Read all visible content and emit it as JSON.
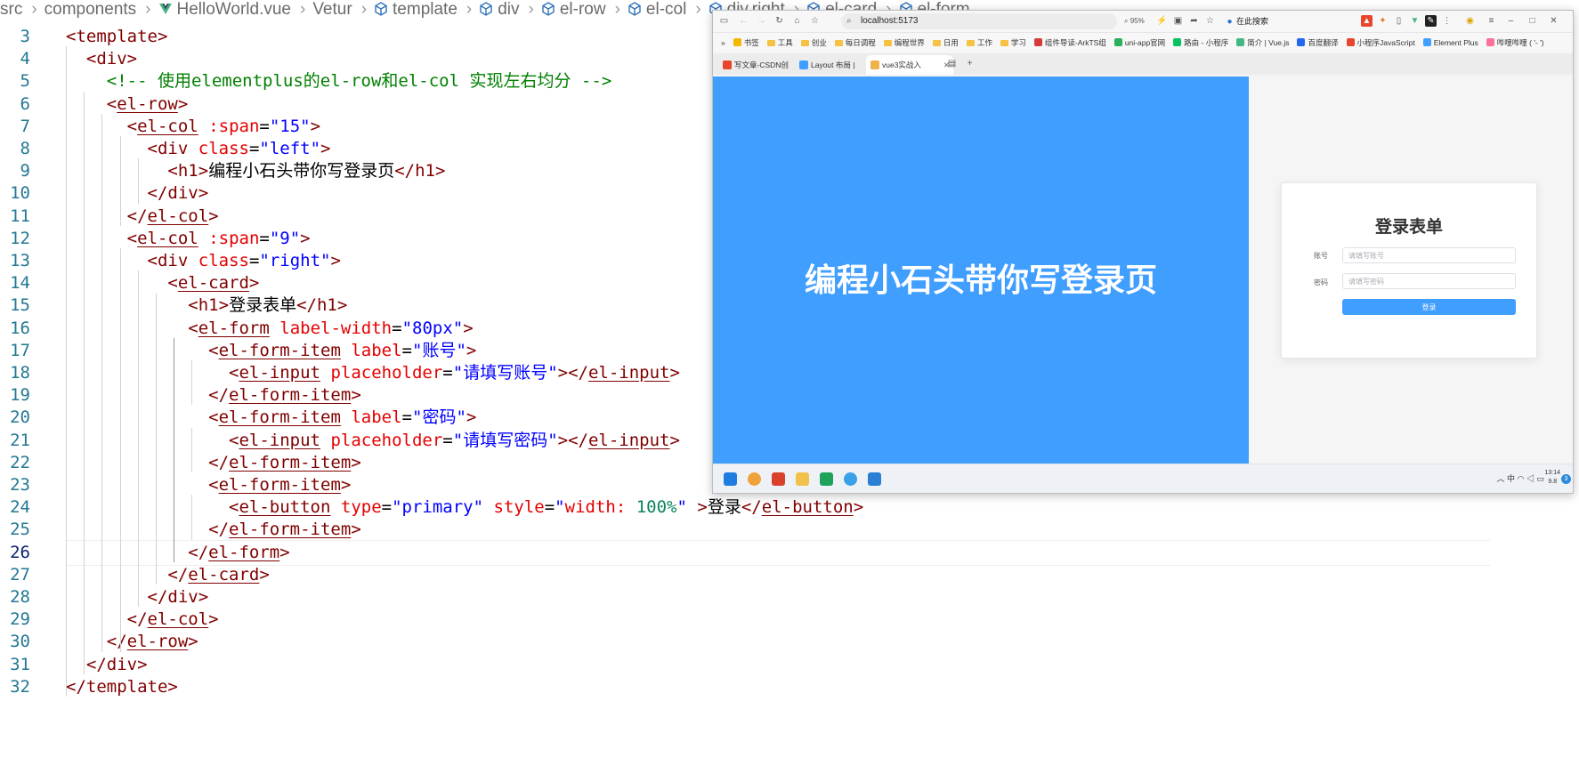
{
  "breadcrumb": [
    "src",
    "components",
    "HelloWorld.vue",
    "Vetur",
    "template",
    "div",
    "el-row",
    "el-col",
    "div.right",
    "el-card",
    "el-form"
  ],
  "editor": {
    "active_line": 26,
    "lines": [
      {
        "n": 3,
        "text": "<template>"
      },
      {
        "n": 4,
        "text": "  <div>"
      },
      {
        "n": 5,
        "text": "    <!-- 使用elementplus的el-row和el-col 实现左右均分 -->"
      },
      {
        "n": 6,
        "text": "    <el-row>"
      },
      {
        "n": 7,
        "text": "      <el-col :span=\"15\">"
      },
      {
        "n": 8,
        "text": "        <div class=\"left\">"
      },
      {
        "n": 9,
        "text": "          <h1>编程小石头带你写登录页</h1>"
      },
      {
        "n": 10,
        "text": "        </div>"
      },
      {
        "n": 11,
        "text": "      </el-col>"
      },
      {
        "n": 12,
        "text": "      <el-col :span=\"9\">"
      },
      {
        "n": 13,
        "text": "        <div class=\"right\">"
      },
      {
        "n": 14,
        "text": "          <el-card>"
      },
      {
        "n": 15,
        "text": "            <h1>登录表单</h1>"
      },
      {
        "n": 16,
        "text": "            <el-form label-width=\"80px\">"
      },
      {
        "n": 17,
        "text": "              <el-form-item label=\"账号\">"
      },
      {
        "n": 18,
        "text": "                <el-input placeholder=\"请填写账号\"></el-input>"
      },
      {
        "n": 19,
        "text": "              </el-form-item>"
      },
      {
        "n": 20,
        "text": "              <el-form-item label=\"密码\">"
      },
      {
        "n": 21,
        "text": "                <el-input placeholder=\"请填写密码\"></el-input>"
      },
      {
        "n": 22,
        "text": "              </el-form-item>"
      },
      {
        "n": 23,
        "text": "              <el-form-item>"
      },
      {
        "n": 24,
        "text": "                <el-button type=\"primary\" style=\"width: 100%\" >登录</el-button>"
      },
      {
        "n": 25,
        "text": "              </el-form-item>"
      },
      {
        "n": 26,
        "text": "            </el-form>"
      },
      {
        "n": 27,
        "text": "          </el-card>"
      },
      {
        "n": 28,
        "text": "        </div>"
      },
      {
        "n": 29,
        "text": "      </el-col>"
      },
      {
        "n": 30,
        "text": "    </el-row>"
      },
      {
        "n": 31,
        "text": "  </div>"
      },
      {
        "n": 32,
        "text": "</template>"
      }
    ]
  },
  "browser": {
    "url": "localhost:5173",
    "zoom": "95%",
    "search_placeholder": "在此搜索",
    "bookmarks": [
      "书签",
      "工具",
      "创业",
      "每日调程",
      "编程世界",
      "日用",
      "工作",
      "学习",
      "组件导读-ArkTS组",
      "uni-app官网",
      "路由 - 小程序",
      "简介 | Vue.js",
      "百度翻译",
      "小程序JavaScript",
      "Element Plus",
      "哔哩哔哩 ( '- ')"
    ],
    "tabs": [
      {
        "label": "写文章-CSDN创",
        "active": false
      },
      {
        "label": "Layout 布局 |",
        "active": false
      },
      {
        "label": "vue3实战入",
        "active": true
      }
    ],
    "page": {
      "hero_title": "编程小石头带你写登录页",
      "card_title": "登录表单",
      "account_label": "账号",
      "account_placeholder": "请填写账号",
      "password_label": "密码",
      "password_placeholder": "请填写密码",
      "login_button": "登录"
    },
    "taskbar": {
      "tray_text": "中",
      "time": "13:14",
      "date": "9.8",
      "notif_count": "3"
    }
  },
  "colors": {
    "hero_bg": "#409eff",
    "primary_button": "#409eff"
  }
}
